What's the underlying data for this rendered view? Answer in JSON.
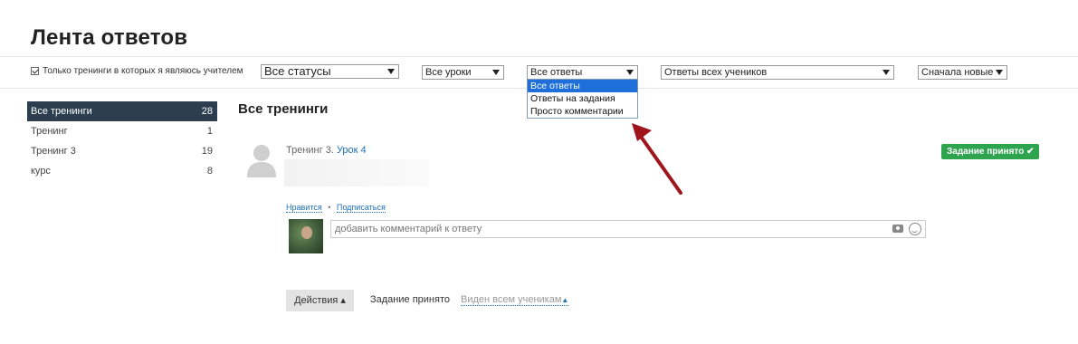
{
  "page": {
    "title": "Лента ответов"
  },
  "filters": {
    "teacher_only_label": "Только тренинги в которых я являюсь учителем",
    "status_select": "Все статусы",
    "lesson_select": "Все уроки",
    "answers_select": "Все ответы",
    "answers_options": [
      "Все ответы",
      "Ответы на задания",
      "Просто комментарии"
    ],
    "students_select": "Ответы всех учеников",
    "sort_select": "Сначала новые"
  },
  "sidebar": {
    "items": [
      {
        "label": "Все тренинги",
        "count": "28"
      },
      {
        "label": "Тренинг",
        "count": "1"
      },
      {
        "label": "Тренинг 3",
        "count": "19"
      },
      {
        "label": "курс",
        "count": "8"
      }
    ]
  },
  "main": {
    "section_title": "Все тренинги",
    "answer": {
      "training_prefix": "Тренинг 3.",
      "lesson_link": "Урок 4",
      "status_badge": "Задание принято ✔",
      "like_label": "Нравится",
      "subscribe_label": "Подписаться",
      "comment_placeholder": "добавить комментарий к ответу",
      "actions_label": "Действия ▴",
      "status_text": "Задание принято",
      "visibility_label": "Виден всем ученикам"
    }
  },
  "colors": {
    "sidebar_active": "#2d3e50",
    "accent_green": "#2ea44f",
    "link_blue": "#1e6fb8",
    "dropdown_selected": "#1e6fd9",
    "annotation_arrow": "#a0141c"
  }
}
